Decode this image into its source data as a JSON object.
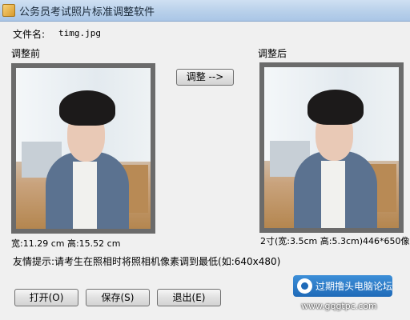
{
  "window": {
    "title": "公务员考试照片标准调整软件"
  },
  "file": {
    "label": "文件名:",
    "value": "timg.jpg"
  },
  "before": {
    "label": "调整前",
    "size": "宽:11.29 cm 高:15.52 cm"
  },
  "after": {
    "label": "调整后",
    "size": "2寸(宽:3.5cm 高:5.3cm)446*650像"
  },
  "adjust_button": "调整 -->",
  "tip": "友情提示:请考生在照相时将照相机像素调到最低(如:640x480)",
  "buttons": {
    "open": "打开(O)",
    "save": "保存(S)",
    "exit": "退出(E)"
  },
  "watermark": {
    "text": "过期撸头电脑论坛",
    "url": "www.gqgtpc.com"
  },
  "colors": {
    "titlebar": "#b8d0ea",
    "photo_frame": "#6b6b6b",
    "watermark_bg": "#1f6ab8"
  }
}
